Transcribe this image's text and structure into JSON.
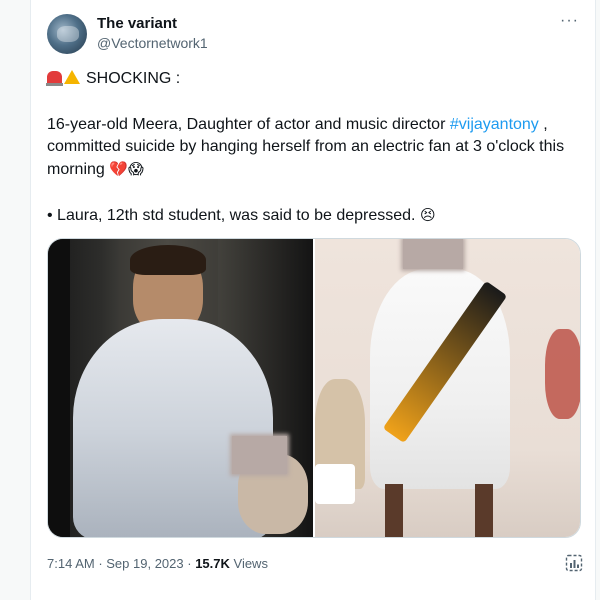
{
  "tweet": {
    "author_name": "The variant",
    "author_handle": "@Vectornetwork1",
    "more_label": "···",
    "line1": "SHOCKING :",
    "line2_before": "16-year-old Meera, Daughter of actor and music director ",
    "hashtag": "#vijayantony",
    "line2_after": " , committed suicide by hanging herself from an electric fan at 3 o'clock this morning",
    "line2_emoji": "💔😱",
    "line3": "• Laura, 12th std student, was said to be depressed.",
    "line3_emoji": "😣",
    "time": "7:14 AM",
    "sep1": " · ",
    "date": "Sep 19, 2023",
    "sep2": " · ",
    "views_count": "15.7K",
    "views_label": " Views",
    "icons": {
      "line1": [
        "siren-icon",
        "warning-icon"
      ],
      "footer": "analytics-icon"
    }
  }
}
